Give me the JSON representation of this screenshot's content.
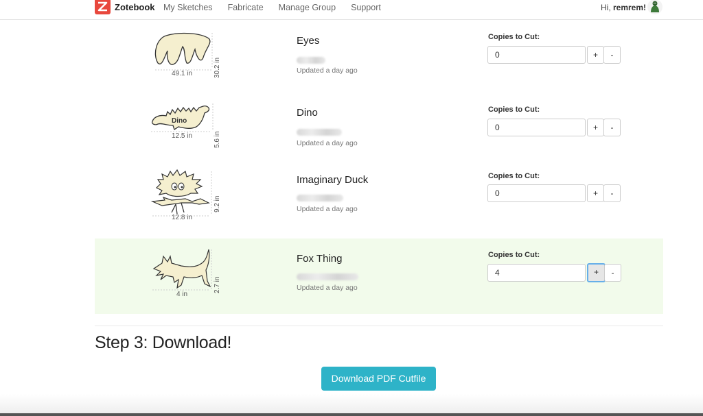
{
  "nav": {
    "brand": "Zotebook",
    "links": [
      "My Sketches",
      "Fabricate",
      "Manage Group",
      "Support"
    ],
    "greeting_prefix": "Hi, ",
    "username": "remrem!"
  },
  "items": [
    {
      "title": "Eyes",
      "width": "49.1 in",
      "height": "30.2 in",
      "updated": "Updated a day ago",
      "copies_label": "Copies to Cut:",
      "copies": "0"
    },
    {
      "title": "Dino",
      "width": "12.5 in",
      "height": "5.6 in",
      "updated": "Updated a day ago",
      "copies_label": "Copies to Cut:",
      "copies": "0",
      "art_text": "Dino"
    },
    {
      "title": "Imaginary Duck",
      "width": "12.8 in",
      "height": "9.2 in",
      "updated": "Updated a day ago",
      "copies_label": "Copies to Cut:",
      "copies": "0"
    },
    {
      "title": "Fox Thing",
      "width": "4 in",
      "height": "2.7 in",
      "updated": "Updated a day ago",
      "copies_label": "Copies to Cut:",
      "copies": "4",
      "selected": true
    }
  ],
  "stepper": {
    "plus": "+",
    "minus": "-"
  },
  "step3": {
    "title": "Step 3: Download!",
    "button": "Download PDF Cutfile"
  },
  "colors": {
    "accent": "#2eb3c8",
    "brand": "#e8483d",
    "selected_bg": "#f2fbeb",
    "shape_fill": "#f5efcf"
  }
}
